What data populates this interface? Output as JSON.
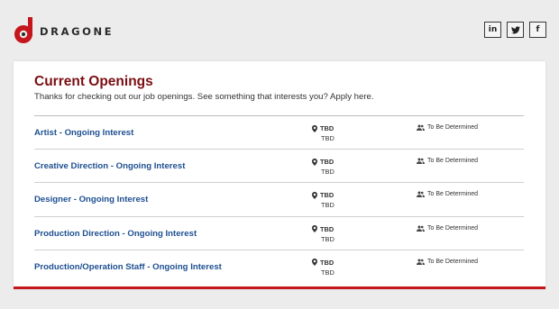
{
  "brand": {
    "name": "DRAGONE",
    "logo_mark": "d",
    "accent": "#c4161c"
  },
  "social": [
    {
      "label": "in",
      "icon": "linkedin-icon"
    },
    {
      "label": "",
      "icon": "twitter-icon"
    },
    {
      "label": "f",
      "icon": "facebook-icon"
    }
  ],
  "main": {
    "title": "Current Openings",
    "subtitle": "Thanks for checking out our job openings. See something that interests you? Apply here.",
    "jobs": [
      {
        "title": "Artist - Ongoing Interest",
        "location": "TBD",
        "location_sub": "TBD",
        "type": "To Be Determined"
      },
      {
        "title": "Creative Direction - Ongoing Interest",
        "location": "TBD",
        "location_sub": "TBD",
        "type": "To Be Determined"
      },
      {
        "title": "Designer - Ongoing Interest",
        "location": "TBD",
        "location_sub": "TBD",
        "type": "To Be Determined"
      },
      {
        "title": "Production Direction - Ongoing Interest",
        "location": "TBD",
        "location_sub": "TBD",
        "type": "To Be Determined"
      },
      {
        "title": "Production/Operation Staff - Ongoing Interest",
        "location": "TBD",
        "location_sub": "TBD",
        "type": "To Be Determined"
      }
    ]
  }
}
